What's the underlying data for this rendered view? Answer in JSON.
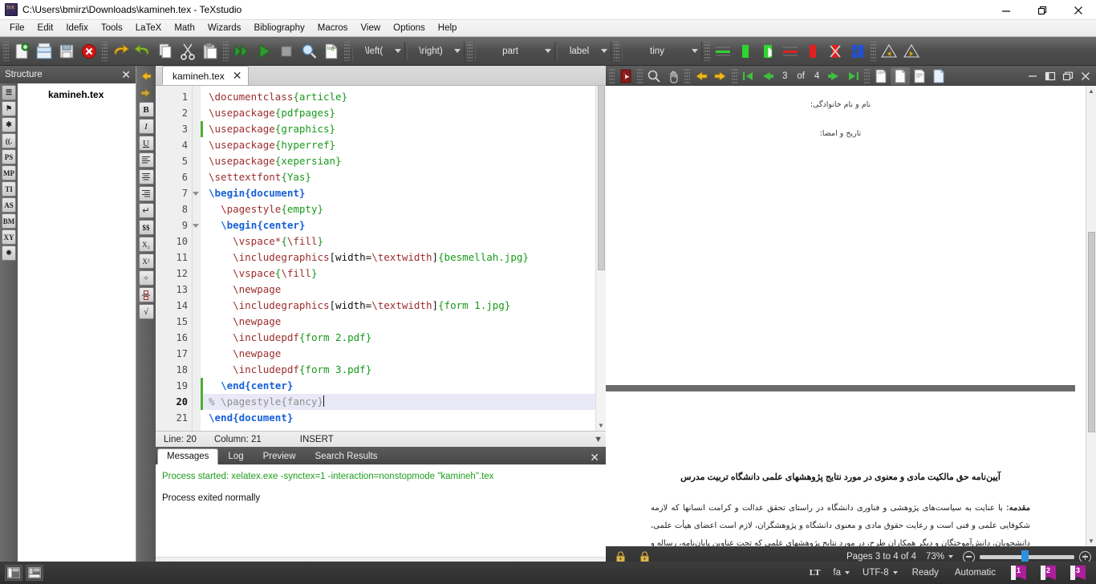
{
  "window": {
    "title": "C:\\Users\\bmirz\\Downloads\\kamineh.tex - TeXstudio",
    "minimize": "—",
    "maximize": "❐",
    "close": "✕"
  },
  "menubar": {
    "items": [
      "File",
      "Edit",
      "Idefix",
      "Tools",
      "LaTeX",
      "Math",
      "Wizards",
      "Bibliography",
      "Macros",
      "View",
      "Options",
      "Help"
    ]
  },
  "toolbar": {
    "icons": [
      {
        "name": "new-document-icon"
      },
      {
        "name": "open-document-icon"
      },
      {
        "name": "save-document-icon"
      },
      {
        "name": "close-document-icon"
      },
      {
        "name": "undo-icon"
      },
      {
        "name": "redo-icon"
      },
      {
        "name": "copy-icon"
      },
      {
        "name": "cut-icon"
      },
      {
        "name": "paste-icon"
      },
      {
        "name": "build-and-view-icon"
      },
      {
        "name": "run-icon"
      },
      {
        "name": "stop-icon"
      },
      {
        "name": "preview-icon"
      },
      {
        "name": "log-icon"
      }
    ],
    "combos": [
      {
        "name": "left-delimiter-combo",
        "label": "\\left("
      },
      {
        "name": "right-delimiter-combo",
        "label": "\\right)"
      },
      {
        "name": "section-combo",
        "label": "part"
      },
      {
        "name": "label-combo",
        "label": "label"
      },
      {
        "name": "font-size-combo",
        "label": "tiny"
      }
    ],
    "right_icons": [
      {
        "name": "highlight-green-line-icon"
      },
      {
        "name": "highlight-green-block-icon"
      },
      {
        "name": "highlight-green-partial-icon"
      },
      {
        "name": "highlight-red-line-icon"
      },
      {
        "name": "highlight-red-block-icon"
      },
      {
        "name": "remove-highlight-icon"
      },
      {
        "name": "blue-marker-icon"
      },
      {
        "name": "previous-change-icon"
      },
      {
        "name": "next-change-icon"
      }
    ]
  },
  "structure": {
    "title": "Structure",
    "close": "✕",
    "rail": [
      "☰",
      "⚑",
      "✱",
      "((.",
      "PS",
      "MP",
      "TI",
      "AS",
      "BM",
      "XY",
      "✸"
    ],
    "root_node": "kamineh.tex"
  },
  "editor_rail": {
    "buttons": [
      "←",
      "→",
      "B",
      "I",
      "U",
      "≡",
      "≡",
      "≡",
      "↵",
      "$$",
      "X₂",
      "X²",
      "÷",
      "▫",
      "√"
    ]
  },
  "editor": {
    "tab": {
      "label": "kamineh.tex",
      "close": "✕"
    },
    "lines": [
      {
        "n": "1",
        "fold": false,
        "changed": false,
        "highlight": false,
        "tokens": [
          {
            "t": "cmd",
            "v": "\\documentclass"
          },
          {
            "t": "arg",
            "v": "{article}"
          }
        ]
      },
      {
        "n": "2",
        "fold": false,
        "changed": false,
        "highlight": false,
        "tokens": [
          {
            "t": "cmd",
            "v": "\\usepackage"
          },
          {
            "t": "arg",
            "v": "{pdfpages}"
          }
        ]
      },
      {
        "n": "3",
        "fold": false,
        "changed": true,
        "highlight": false,
        "tokens": [
          {
            "t": "cmd",
            "v": "\\usepackage"
          },
          {
            "t": "arg",
            "v": "{graphics}"
          }
        ]
      },
      {
        "n": "4",
        "fold": false,
        "changed": false,
        "highlight": false,
        "tokens": [
          {
            "t": "cmd",
            "v": "\\usepackage"
          },
          {
            "t": "arg",
            "v": "{hyperref}"
          }
        ]
      },
      {
        "n": "5",
        "fold": false,
        "changed": false,
        "highlight": false,
        "tokens": [
          {
            "t": "cmd",
            "v": "\\usepackage"
          },
          {
            "t": "arg",
            "v": "{xepersian}"
          }
        ]
      },
      {
        "n": "6",
        "fold": false,
        "changed": false,
        "highlight": false,
        "tokens": [
          {
            "t": "cmd",
            "v": "\\settextfont"
          },
          {
            "t": "arg",
            "v": "{Yas}"
          }
        ]
      },
      {
        "n": "7",
        "fold": true,
        "changed": false,
        "highlight": false,
        "tokens": [
          {
            "t": "env",
            "v": "\\begin{document}"
          }
        ]
      },
      {
        "n": "8",
        "fold": false,
        "changed": false,
        "highlight": false,
        "tokens": [
          {
            "t": "plain",
            "v": "  "
          },
          {
            "t": "cmd",
            "v": "\\pagestyle"
          },
          {
            "t": "arg",
            "v": "{empty}"
          }
        ]
      },
      {
        "n": "9",
        "fold": true,
        "changed": false,
        "highlight": false,
        "tokens": [
          {
            "t": "plain",
            "v": "  "
          },
          {
            "t": "env",
            "v": "\\begin{center}"
          }
        ]
      },
      {
        "n": "10",
        "fold": false,
        "changed": false,
        "highlight": false,
        "tokens": [
          {
            "t": "plain",
            "v": "    "
          },
          {
            "t": "cmd",
            "v": "\\vspace*"
          },
          {
            "t": "arg",
            "v": "{"
          },
          {
            "t": "cmd",
            "v": "\\fill"
          },
          {
            "t": "arg",
            "v": "}"
          }
        ]
      },
      {
        "n": "11",
        "fold": false,
        "changed": false,
        "highlight": false,
        "tokens": [
          {
            "t": "plain",
            "v": "    "
          },
          {
            "t": "cmd",
            "v": "\\includegraphics"
          },
          {
            "t": "opt",
            "v": "[width="
          },
          {
            "t": "cmd",
            "v": "\\textwidth"
          },
          {
            "t": "opt",
            "v": "]"
          },
          {
            "t": "arg",
            "v": "{besmellah.jpg}"
          }
        ]
      },
      {
        "n": "12",
        "fold": false,
        "changed": false,
        "highlight": false,
        "tokens": [
          {
            "t": "plain",
            "v": "    "
          },
          {
            "t": "cmd",
            "v": "\\vspace"
          },
          {
            "t": "arg",
            "v": "{"
          },
          {
            "t": "cmd",
            "v": "\\fill"
          },
          {
            "t": "arg",
            "v": "}"
          }
        ]
      },
      {
        "n": "13",
        "fold": false,
        "changed": false,
        "highlight": false,
        "tokens": [
          {
            "t": "plain",
            "v": "    "
          },
          {
            "t": "cmd",
            "v": "\\newpage"
          }
        ]
      },
      {
        "n": "14",
        "fold": false,
        "changed": false,
        "highlight": false,
        "tokens": [
          {
            "t": "plain",
            "v": "    "
          },
          {
            "t": "cmd",
            "v": "\\includegraphics"
          },
          {
            "t": "opt",
            "v": "[width="
          },
          {
            "t": "cmd",
            "v": "\\textwidth"
          },
          {
            "t": "opt",
            "v": "]"
          },
          {
            "t": "arg",
            "v": "{form 1.jpg}"
          }
        ]
      },
      {
        "n": "15",
        "fold": false,
        "changed": false,
        "highlight": false,
        "tokens": [
          {
            "t": "plain",
            "v": "    "
          },
          {
            "t": "cmd",
            "v": "\\newpage"
          }
        ]
      },
      {
        "n": "16",
        "fold": false,
        "changed": false,
        "highlight": false,
        "tokens": [
          {
            "t": "plain",
            "v": "    "
          },
          {
            "t": "cmd",
            "v": "\\includepdf"
          },
          {
            "t": "arg",
            "v": "{form 2.pdf}"
          }
        ]
      },
      {
        "n": "17",
        "fold": false,
        "changed": false,
        "highlight": false,
        "tokens": [
          {
            "t": "plain",
            "v": "    "
          },
          {
            "t": "cmd",
            "v": "\\newpage"
          }
        ]
      },
      {
        "n": "18",
        "fold": false,
        "changed": false,
        "highlight": false,
        "tokens": [
          {
            "t": "plain",
            "v": "    "
          },
          {
            "t": "cmd",
            "v": "\\includepdf"
          },
          {
            "t": "arg",
            "v": "{form 3.pdf}"
          }
        ]
      },
      {
        "n": "19",
        "fold": false,
        "changed": true,
        "highlight": false,
        "tokens": [
          {
            "t": "plain",
            "v": "  "
          },
          {
            "t": "env",
            "v": "\\end{center}"
          }
        ]
      },
      {
        "n": "20",
        "fold": false,
        "changed": true,
        "highlight": true,
        "caret": true,
        "tokens": [
          {
            "t": "com",
            "v": "% \\pagestyle{fancy}"
          }
        ]
      },
      {
        "n": "21",
        "fold": false,
        "changed": false,
        "highlight": false,
        "tokens": [
          {
            "t": "env",
            "v": "\\end{document}"
          }
        ]
      }
    ],
    "status": {
      "line": "Line: 20",
      "column": "Column: 21",
      "mode": "INSERT"
    }
  },
  "messages": {
    "tabs": [
      "Messages",
      "Log",
      "Preview",
      "Search Results"
    ],
    "active_tab": "Messages",
    "close": "✕",
    "lines": [
      {
        "text": "Process started: xelatex.exe -synctex=1 -interaction=nonstopmode \"kamineh\".tex",
        "style": "ok"
      },
      {
        "text": "Process exited normally",
        "style": "plain"
      }
    ]
  },
  "viewer": {
    "toolbar": {
      "pdf-icon": "pdf-logo-icon",
      "magnify": "magnifier-icon",
      "hand": "hand-tool-icon",
      "back": "go-back-icon",
      "forward": "go-forward-icon",
      "first": "first-page-icon",
      "prev": "previous-page-icon",
      "next": "next-page-icon",
      "last": "last-page-icon",
      "page_current": "3",
      "page_of": "of",
      "page_total": "4",
      "fit_width": "fit-width-icon",
      "fit_page": "fit-page-icon",
      "single_page": "single-page-icon",
      "continuous": "continuous-page-icon",
      "minimize": "—",
      "maximize_restore": "▣",
      "detach": "❐",
      "close": "✕"
    },
    "page3": {
      "line1": "نام و نام خانوادگی:",
      "line2": "تاریخ و امضا:"
    },
    "page4": {
      "title": "آیین‌نامه حق مالکیت مادی و معنوی در مورد نتایج پژوهشهای علمی دانشگاه تربیت مدرس",
      "para_lead": "مقدمه:",
      "para": " با عنایت به سیاست‌های پژوهشی و فناوری دانشگاه در راستای تحقق عدالت و کرامت انسانها که لازمه شکوفایی علمی و فنی است و رعایت حقوق مادی و معنوی دانشگاه و پژوهشگران، لازم است اعضای هیأت علمی، دانشجویان، دانش‌آموختگان و دیگر همکاران طرح، در مورد نتایج پژوهشهای علمی که تحت عناوین پایان‌نامه، رساله و طرحهای تحقیقاتی با هماهنگی"
    },
    "bottom": {
      "lock1": "lock-scroll-icon",
      "lock2": "lock-zoom-icon",
      "pages_label": "Pages 3 to 4 of 4",
      "zoom_value": "73%",
      "zoom_out": "zoom-out-icon",
      "zoom_in": "zoom-in-icon"
    }
  },
  "statusbar": {
    "panel_left": "toggle-left-panel-icon",
    "panel_bottom": "toggle-bottom-panel-icon",
    "languagetool": "LT",
    "language": "fa",
    "encoding": "UTF-8",
    "state": "Ready",
    "build_mode": "Automatic",
    "bookmarks": [
      "1",
      "2",
      "3"
    ]
  },
  "colors": {
    "accent_blue": "#2f8fe0",
    "command_red": "#9c2d2d",
    "argument_green": "#18991a",
    "environment_blue": "#1760d8",
    "comment_gray": "#8f8f8f",
    "bookmark_magenta": "#ad1e9b",
    "success_green": "#1d9e1d"
  }
}
